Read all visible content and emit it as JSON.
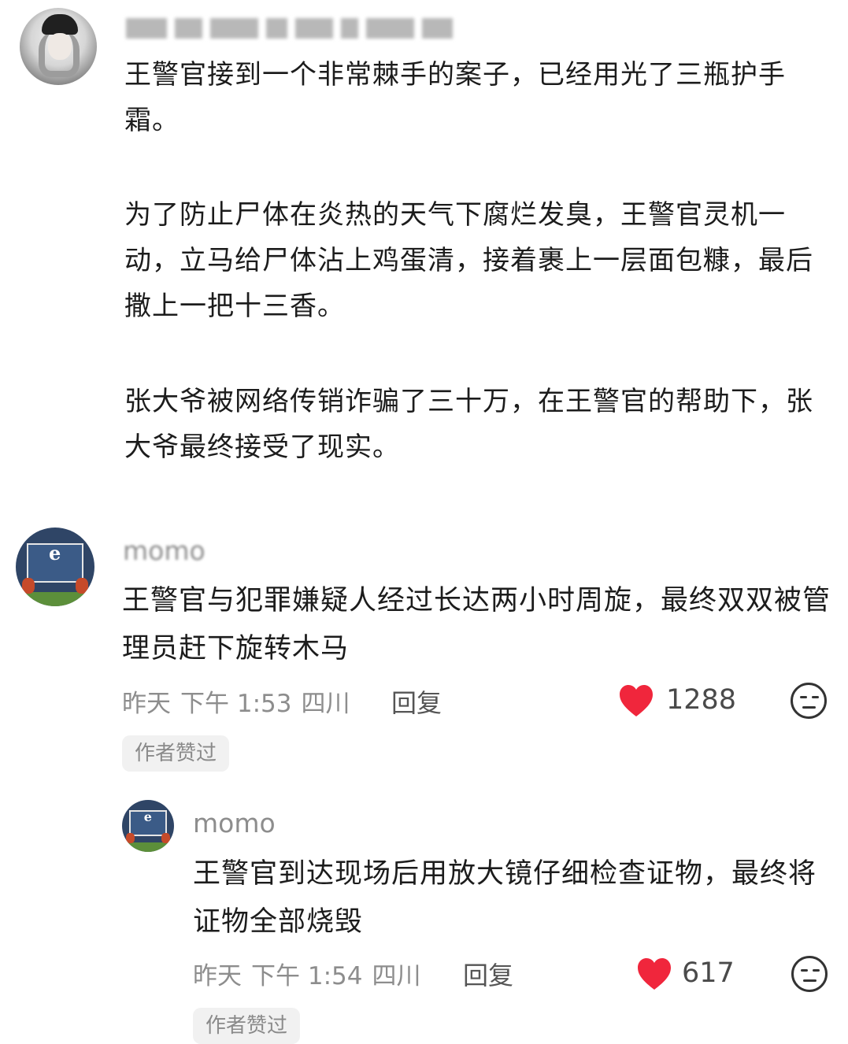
{
  "post": {
    "author_name": "",
    "paragraphs": [
      "王警官接到一个非常棘手的案子，已经用光了三瓶护手霜。",
      "为了防止尸体在炎热的天气下腐烂发臭，王警官灵机一动，立马给尸体沾上鸡蛋清，接着裹上一层面包糠，最后撒上一把十三香。",
      "张大爷被网络传销诈骗了三十万，在王警官的帮助下，张大爷最终接受了现实。"
    ]
  },
  "comments": [
    {
      "author": "momo",
      "body": "王警官与犯罪嫌疑人经过长达两小时周旋，最终双双被管理员赶下旋转木马",
      "date": "昨天",
      "time": "下午 1:53",
      "location": "四川",
      "reply_label": "回复",
      "likes": "1288",
      "badge": "作者赞过"
    },
    {
      "author": "momo",
      "body": "王警官到达现场后用放大镜仔细检查证物，最终将证物全部烧毁",
      "date": "昨天",
      "time": "下午 1:54",
      "location": "四川",
      "reply_label": "回复",
      "likes": "617",
      "badge": "作者赞过"
    }
  ],
  "icons": {
    "like": "heart-icon",
    "dislike": "dislike-face-icon"
  },
  "colors": {
    "like": "#f0263c",
    "meta_text": "#8d8d8d",
    "badge_bg": "#f1f1f1"
  }
}
